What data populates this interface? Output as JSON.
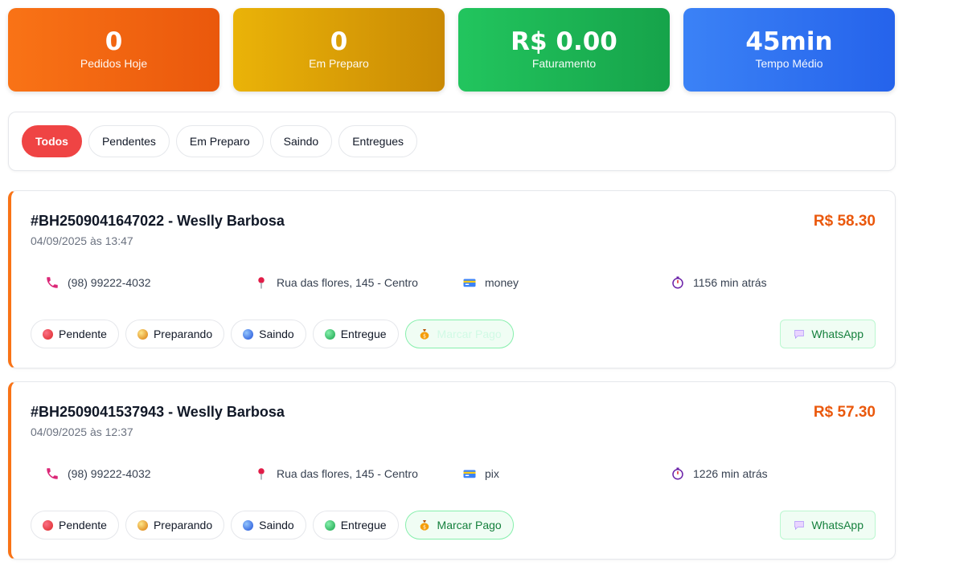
{
  "stats": [
    {
      "value": "0",
      "label": "Pedidos Hoje",
      "color": "#f97316"
    },
    {
      "value": "0",
      "label": "Em Preparo",
      "color": "#eab308"
    },
    {
      "value": "R$ 0.00",
      "label": "Faturamento",
      "color": "#22c55e"
    },
    {
      "value": "45min",
      "label": "Tempo Médio",
      "color": "#3b82f6"
    }
  ],
  "filters": [
    "Todos",
    "Pendentes",
    "Em Preparo",
    "Saindo",
    "Entregues"
  ],
  "active_filter": "Todos",
  "actions": {
    "pendente": "Pendente",
    "preparando": "Preparando",
    "saindo": "Saindo",
    "entregue": "Entregue",
    "marcar_pago": "Marcar Pago",
    "whatsapp": "WhatsApp"
  },
  "orders": [
    {
      "title": "#BH2509041647022 - Weslly Barbosa",
      "date": "04/09/2025 às 13:47",
      "price": "R$ 58.30",
      "phone": "(98) 99222-4032",
      "address": "Rua das flores, 145 - Centro",
      "payment": "money",
      "elapsed": "1156 min atrás"
    },
    {
      "title": "#BH2509041537943 - Weslly Barbosa",
      "date": "04/09/2025 às 12:37",
      "price": "R$ 57.30",
      "phone": "(98) 99222-4032",
      "address": "Rua das flores, 145 - Centro",
      "payment": "pix",
      "elapsed": "1226 min atrás"
    }
  ],
  "icons": {
    "phone": "phone-icon",
    "pin": "location-pin-icon",
    "card": "credit-card-icon",
    "timer": "stopwatch-icon",
    "money_bag": "money-bag-icon",
    "chat": "chat-bubble-icon"
  },
  "accent": "#ea580c"
}
